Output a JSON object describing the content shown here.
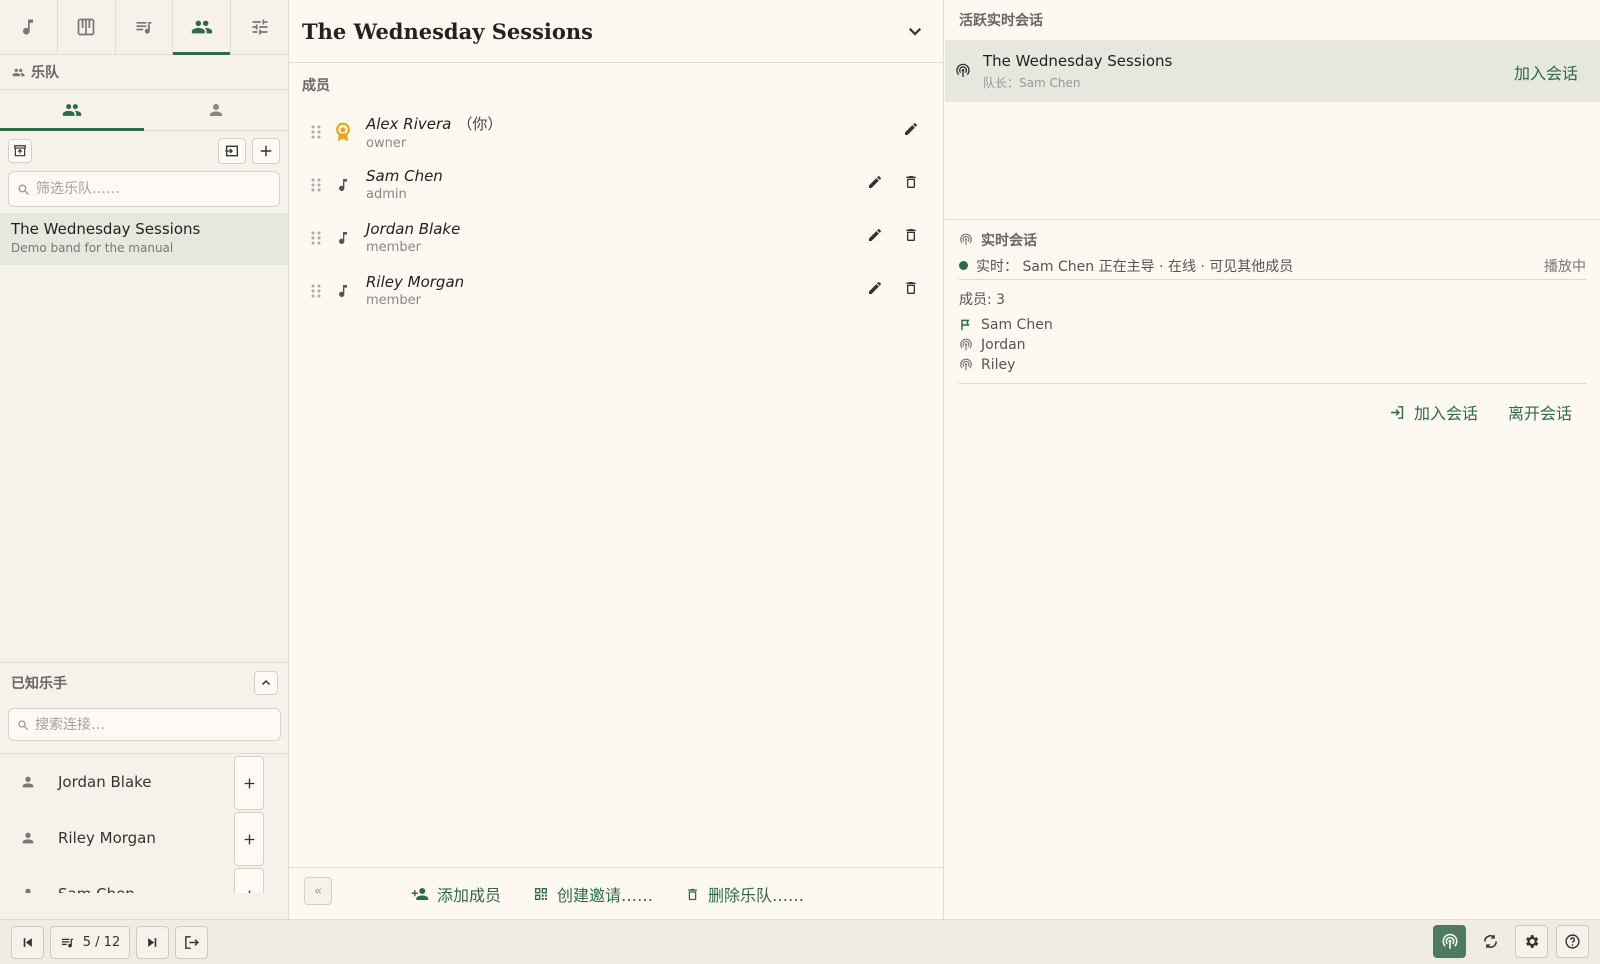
{
  "left": {
    "top_tabs": [
      {
        "icon": "music-note-icon"
      },
      {
        "icon": "piano-icon"
      },
      {
        "icon": "playlist-icon"
      },
      {
        "icon": "people-icon",
        "active": true
      },
      {
        "icon": "sliders-icon"
      }
    ],
    "section_title": "乐队",
    "sub_tabs": [
      {
        "icon": "people-icon",
        "active": true
      },
      {
        "icon": "person-icon"
      }
    ],
    "filter_placeholder": "筛选乐队……",
    "bands": [
      {
        "name": "The Wednesday Sessions",
        "description": "Demo band for the manual"
      }
    ],
    "known_title": "已知乐手",
    "known_search_placeholder": "搜索连接…",
    "known_musicians": [
      {
        "name": "Jordan Blake"
      },
      {
        "name": "Riley Morgan"
      },
      {
        "name": "Sam Chen"
      }
    ]
  },
  "middle": {
    "title": "The Wednesday Sessions",
    "members_label": "成员",
    "members": [
      {
        "name": "Alex Rivera",
        "you": "（你）",
        "role": "owner"
      },
      {
        "name": "Sam Chen",
        "you": "",
        "role": "admin"
      },
      {
        "name": "Jordan Blake",
        "you": "",
        "role": "member"
      },
      {
        "name": "Riley Morgan",
        "you": "",
        "role": "member"
      }
    ],
    "footer": {
      "collapse": "«",
      "add_member": "添加成员",
      "create_invite": "创建邀请……",
      "delete_band": "删除乐队……"
    }
  },
  "right": {
    "active_label": "活跃实时会话",
    "session": {
      "name": "The Wednesday Sessions",
      "leader": "队长：Sam Chen",
      "join": "加入会话"
    },
    "live": {
      "title": "实时会话",
      "status": "实时： Sam Chen 正在主导 · 在线 · 可见其他成员",
      "playing": "播放中",
      "count": "成员: 3",
      "participants": [
        {
          "name": "Sam Chen",
          "icon": "flag-icon"
        },
        {
          "name": "Jordan",
          "icon": "broadcast-icon"
        },
        {
          "name": "Riley",
          "icon": "broadcast-icon"
        }
      ],
      "join": "加入会话",
      "leave": "离开会话"
    }
  },
  "bottom": {
    "position": "5 / 12"
  },
  "colors": {
    "accent": "#2e6b45",
    "selected_bg": "#e6e7dd",
    "background": "#fdf8f1",
    "owner_badge": "#e8a317"
  }
}
